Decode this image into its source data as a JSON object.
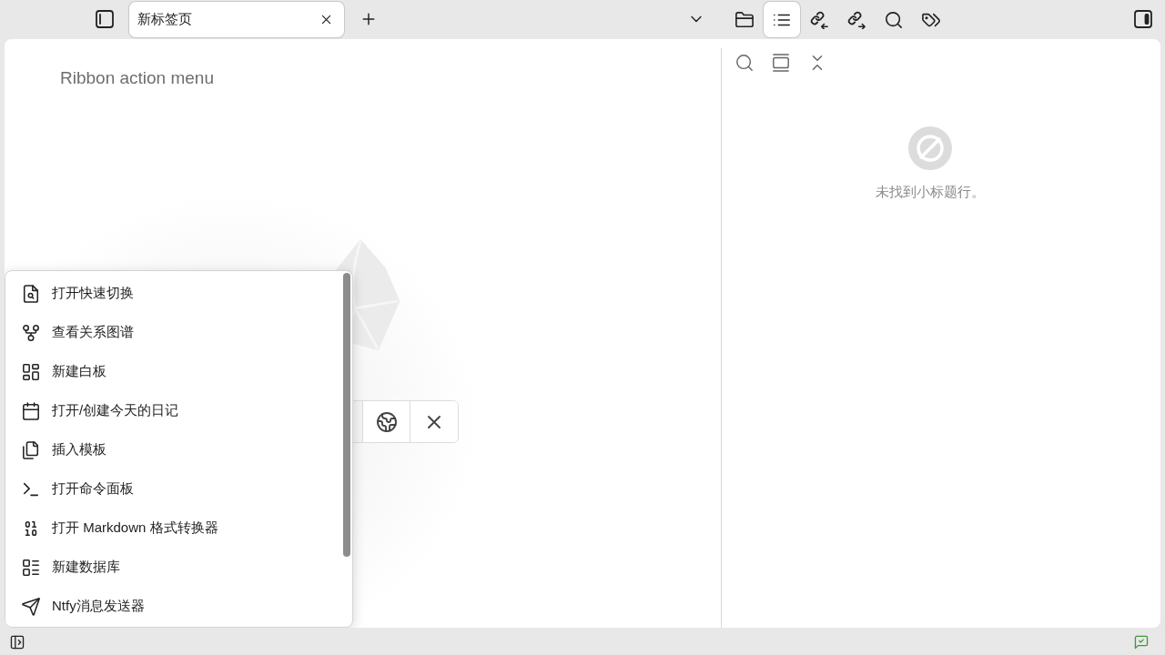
{
  "tab_bar": {
    "tabs": [
      {
        "title": "新标签页",
        "selected": true
      }
    ]
  },
  "sidebar_tabs": [
    {
      "selected": false
    },
    {
      "selected": true
    },
    {
      "selected": false
    },
    {
      "selected": false
    },
    {
      "selected": false
    },
    {
      "selected": false
    }
  ],
  "editor": {
    "title": "Ribbon action menu"
  },
  "ribbon_menu": {
    "items": [
      {
        "label": "打开快速切换"
      },
      {
        "label": "查看关系图谱"
      },
      {
        "label": "新建白板"
      },
      {
        "label": "打开/创建今天的日记"
      },
      {
        "label": "插入模板"
      },
      {
        "label": "打开命令面板"
      },
      {
        "label": "打开 Markdown 格式转换器"
      },
      {
        "label": "新建数据库"
      },
      {
        "label": "Ntfy消息发送器"
      }
    ]
  },
  "outline": {
    "empty_message": "未找到小标题行。"
  }
}
